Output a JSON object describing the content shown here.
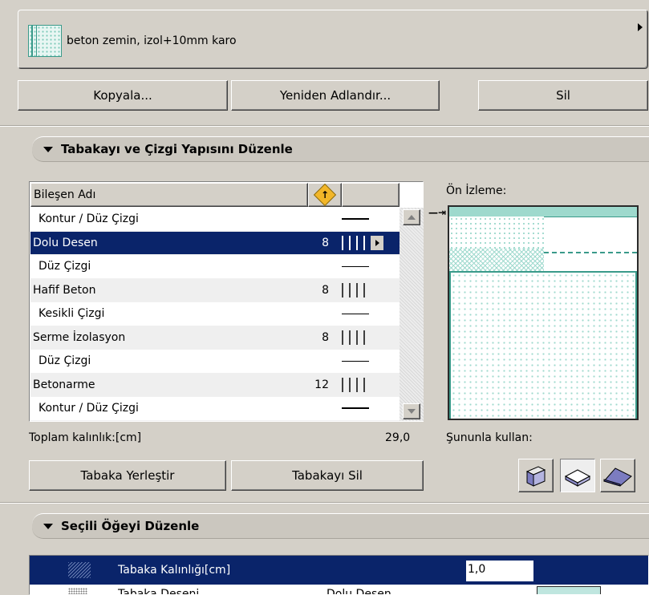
{
  "composite": {
    "name": "beton zemin, izol+10mm karo"
  },
  "toolbar": {
    "copy_label": "Kopyala...",
    "rename_label": "Yeniden Adlandır...",
    "delete_label": "Sil"
  },
  "section_layers": {
    "title": "Tabakayı ve Çizgi Yapısını Düzenle"
  },
  "table": {
    "col_name": "Bileşen Adı",
    "rows": [
      {
        "name": "Kontur /  Düz Çizgi",
        "num": "",
        "kind": "line",
        "line": "thick"
      },
      {
        "name": "Dolu Desen",
        "num": "8",
        "kind": "fill",
        "selected": true
      },
      {
        "name": "Düz Çizgi",
        "num": "",
        "kind": "line",
        "line": "thin"
      },
      {
        "name": "Hafif Beton",
        "num": "8",
        "kind": "fill"
      },
      {
        "name": "Kesikli Çizgi",
        "num": "",
        "kind": "line",
        "line": "thin"
      },
      {
        "name": "Serme İzolasyon",
        "num": "8",
        "kind": "fill"
      },
      {
        "name": "Düz Çizgi",
        "num": "",
        "kind": "line",
        "line": "thin"
      },
      {
        "name": "Betonarme",
        "num": "12",
        "kind": "fill"
      },
      {
        "name": "Kontur /  Düz Çizgi",
        "num": "",
        "kind": "line",
        "line": "thick"
      }
    ]
  },
  "total": {
    "label": "Toplam kalınlık:[cm]",
    "value": "29,0"
  },
  "preview": {
    "label": "Ön İzleme:"
  },
  "use_with": {
    "label": "Şununla kullan:"
  },
  "layer_buttons": {
    "place_label": "Tabaka Yerleştir",
    "delete_label": "Tabakayı Sil"
  },
  "section_selected": {
    "title": "Seçili Öğeyi Düzenle"
  },
  "selected_item": {
    "label": "Tabaka Kalınlığı[cm]",
    "value": "1,0",
    "row2_label": "Tabaka Deseni",
    "row2_value": "Dolu Desen"
  },
  "colors": {
    "selection": "#0a246a",
    "fill_accent": "#3a9a8a",
    "fill_light": "#bfe6df"
  }
}
